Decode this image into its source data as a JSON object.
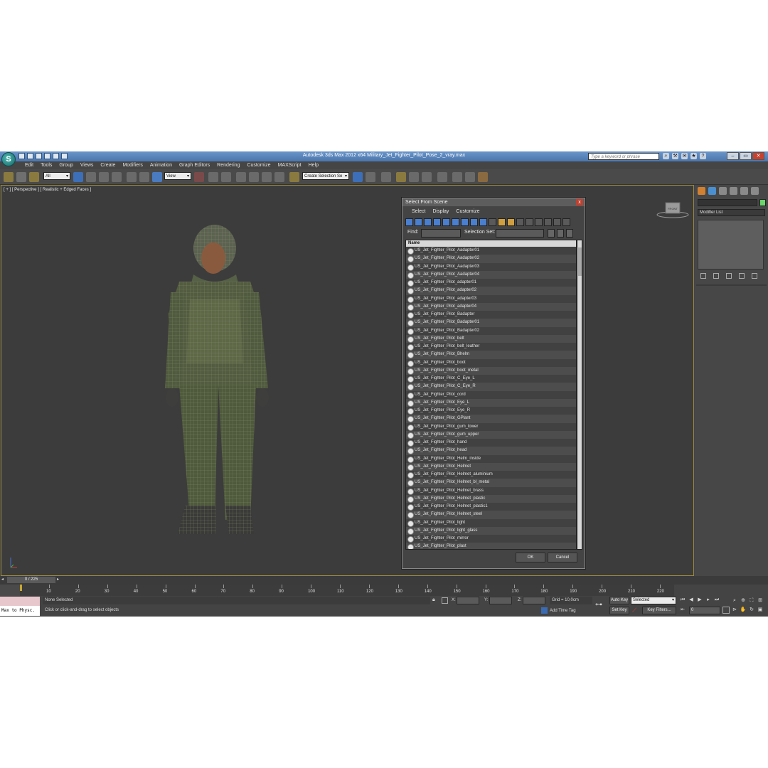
{
  "window": {
    "title": "Autodesk 3ds Max  2012 x64      Military_Jet_Fighter_Pilot_Pose_2_vray.max",
    "search_placeholder": "Type a keyword or phrase"
  },
  "menu": [
    "Edit",
    "Tools",
    "Group",
    "Views",
    "Create",
    "Modifiers",
    "Animation",
    "Graph Editors",
    "Rendering",
    "Customize",
    "MAXScript",
    "Help"
  ],
  "toolbar": {
    "selection_filter": "All",
    "reference_coord": "View",
    "named_selection": "Create Selection Se"
  },
  "viewport": {
    "label": "[ + ] [ Perspective ] [ Realistic + Edged Faces ]",
    "viewcube_label": "FRONT"
  },
  "dialog": {
    "title": "Select From Scene",
    "close": "x",
    "menu": [
      "Select",
      "Display",
      "Customize"
    ],
    "find_label": "Find:",
    "selection_set_label": "Selection Set:",
    "column_name": "Name",
    "items": [
      "US_Jet_Fighter_Pilot_Aadapter01",
      "US_Jet_Fighter_Pilot_Aadapter02",
      "US_Jet_Fighter_Pilot_Aadapter03",
      "US_Jet_Fighter_Pilot_Aadapter04",
      "US_Jet_Fighter_Pilot_adapter01",
      "US_Jet_Fighter_Pilot_adapter02",
      "US_Jet_Fighter_Pilot_adapter03",
      "US_Jet_Fighter_Pilot_adapter04",
      "US_Jet_Fighter_Pilot_Badapter",
      "US_Jet_Fighter_Pilot_Badapter01",
      "US_Jet_Fighter_Pilot_Badapter02",
      "US_Jet_Fighter_Pilot_belt",
      "US_Jet_Fighter_Pilot_belt_leather",
      "US_Jet_Fighter_Pilot_Bhelm",
      "US_Jet_Fighter_Pilot_boot",
      "US_Jet_Fighter_Pilot_boot_metal",
      "US_Jet_Fighter_Pilot_C_Eye_L",
      "US_Jet_Fighter_Pilot_C_Eye_R",
      "US_Jet_Fighter_Pilot_cord",
      "US_Jet_Fighter_Pilot_Eye_L",
      "US_Jet_Fighter_Pilot_Eye_R",
      "US_Jet_Fighter_Pilot_GPlant",
      "US_Jet_Fighter_Pilot_gum_lower",
      "US_Jet_Fighter_Pilot_gum_upper",
      "US_Jet_Fighter_Pilot_hand",
      "US_Jet_Fighter_Pilot_head",
      "US_Jet_Fighter_Pilot_Helm_inside",
      "US_Jet_Fighter_Pilot_Helmet",
      "US_Jet_Fighter_Pilot_Helmet_aluminium",
      "US_Jet_Fighter_Pilot_Helmet_bl_metal",
      "US_Jet_Fighter_Pilot_Helmet_brass",
      "US_Jet_Fighter_Pilot_Helmet_plastic",
      "US_Jet_Fighter_Pilot_Helmet_plastic1",
      "US_Jet_Fighter_Pilot_Helmet_steel",
      "US_Jet_Fighter_Pilot_light",
      "US_Jet_Fighter_Pilot_light_glass",
      "US_Jet_Fighter_Pilot_mirror",
      "US_Jet_Fighter_Pilot_plast"
    ],
    "ok": "OK",
    "cancel": "Cancel"
  },
  "command_panel": {
    "modifier_list": "Modifier List"
  },
  "timeline": {
    "frame_display": "0 / 225",
    "ruler": [
      "10",
      "20",
      "30",
      "40",
      "50",
      "60",
      "70",
      "80",
      "90",
      "100",
      "110",
      "120",
      "130",
      "140",
      "150",
      "160",
      "170",
      "180",
      "190",
      "200",
      "210",
      "220"
    ]
  },
  "status": {
    "maxscript_listener": "Max to Physc.",
    "selection": "None Selected",
    "prompt": "Click or click-and-drag to select objects",
    "x_label": "X:",
    "y_label": "Y:",
    "z_label": "Z:",
    "grid": "Grid = 10,0cm",
    "add_time_tag": "Add Time Tag",
    "auto_key": "Auto Key",
    "set_key": "Set Key",
    "key_mode": "Selected",
    "key_filters": "Key Filters...",
    "current_frame": "0"
  },
  "colors": {
    "title_bar": "#5a86bd",
    "viewport_bg": "#3c3c3c",
    "active_viewport_border": "#9b8a3f",
    "maxscript_top": "#e7c7cc",
    "object_color_swatch": "#6cd46c"
  }
}
